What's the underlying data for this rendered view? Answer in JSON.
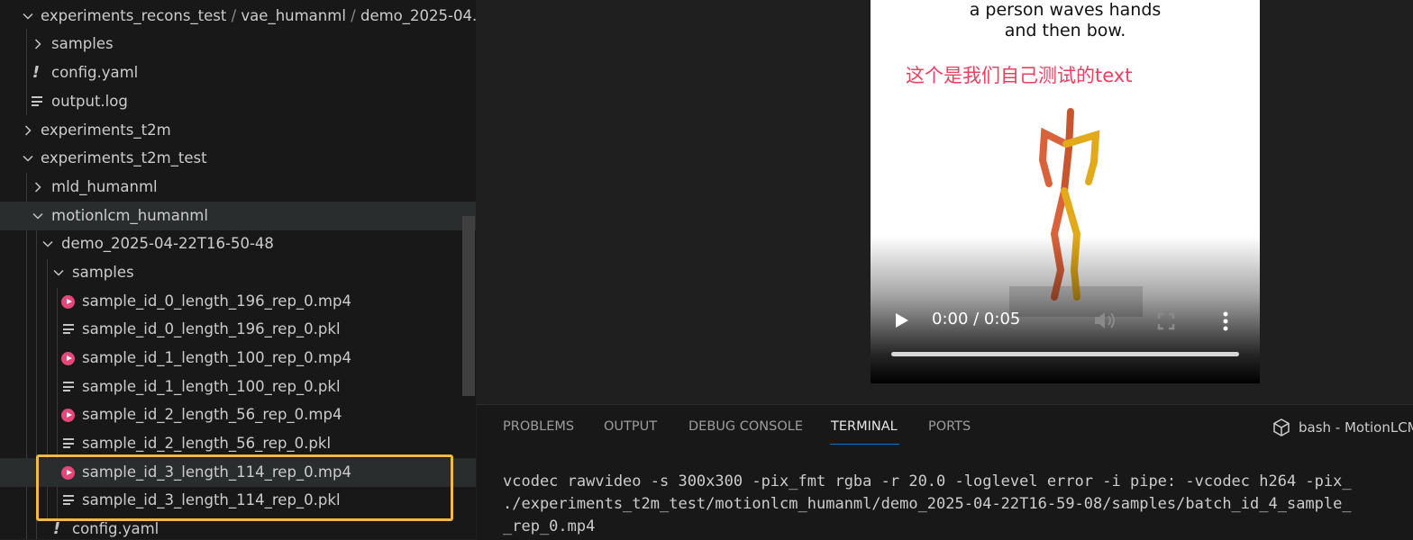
{
  "explorer": {
    "items": [
      {
        "type": "folder",
        "expanded": true,
        "icon": "chevron-down-icon",
        "label": "experiments_recons_test",
        "path_parts": [
          "vae_humanml",
          "demo_2025-04..."
        ]
      },
      {
        "type": "folder",
        "expanded": false,
        "icon": "chevron-right-icon",
        "label": "samples"
      },
      {
        "type": "file",
        "icon": "yaml-icon",
        "label": "config.yaml"
      },
      {
        "type": "file",
        "icon": "lines-icon",
        "label": "output.log"
      },
      {
        "type": "folder",
        "expanded": false,
        "icon": "chevron-right-icon",
        "label": "experiments_t2m"
      },
      {
        "type": "folder",
        "expanded": true,
        "icon": "chevron-down-icon",
        "label": "experiments_t2m_test"
      },
      {
        "type": "folder",
        "expanded": false,
        "icon": "chevron-right-icon",
        "label": "mld_humanml"
      },
      {
        "type": "folder",
        "expanded": true,
        "icon": "chevron-down-icon",
        "label": "motionlcm_humanml"
      },
      {
        "type": "folder",
        "expanded": true,
        "icon": "chevron-down-icon",
        "label": "demo_2025-04-22T16-50-48"
      },
      {
        "type": "folder",
        "expanded": true,
        "icon": "chevron-down-icon",
        "label": "samples"
      },
      {
        "type": "file",
        "icon": "mp4-icon",
        "label": "sample_id_0_length_196_rep_0.mp4"
      },
      {
        "type": "file",
        "icon": "lines-icon",
        "label": "sample_id_0_length_196_rep_0.pkl"
      },
      {
        "type": "file",
        "icon": "mp4-icon",
        "label": "sample_id_1_length_100_rep_0.mp4"
      },
      {
        "type": "file",
        "icon": "lines-icon",
        "label": "sample_id_1_length_100_rep_0.pkl"
      },
      {
        "type": "file",
        "icon": "mp4-icon",
        "label": "sample_id_2_length_56_rep_0.mp4"
      },
      {
        "type": "file",
        "icon": "lines-icon",
        "label": "sample_id_2_length_56_rep_0.pkl"
      },
      {
        "type": "file",
        "icon": "mp4-icon",
        "label": "sample_id_3_length_114_rep_0.mp4",
        "selected": true
      },
      {
        "type": "file",
        "icon": "lines-icon",
        "label": "sample_id_3_length_114_rep_0.pkl"
      },
      {
        "type": "file",
        "icon": "yaml-icon",
        "label": "config.yaml"
      }
    ],
    "path_separator": "/",
    "highlight_color": "#f4b942"
  },
  "video": {
    "caption_line1": "a person waves hands",
    "caption_line2": "and then bow.",
    "note": "这个是我们自己测试的text",
    "time": "0:00 / 0:05",
    "progress": 0,
    "note_color": "#ef3e5e"
  },
  "panel": {
    "tabs": [
      "PROBLEMS",
      "OUTPUT",
      "DEBUG CONSOLE",
      "TERMINAL",
      "PORTS"
    ],
    "active_tab": "TERMINAL",
    "terminal_name": "bash - MotionLCM",
    "terminal_lines": [
      "vcodec rawvideo -s 300x300 -pix_fmt rgba -r 20.0 -loglevel error -i pipe: -vcodec h264 -pix_",
      "./experiments_t2m_test/motionlcm_humanml/demo_2025-04-22T16-59-08/samples/batch_id_4_sample_",
      "_rep_0.mp4"
    ],
    "accent": "#0078d4"
  }
}
